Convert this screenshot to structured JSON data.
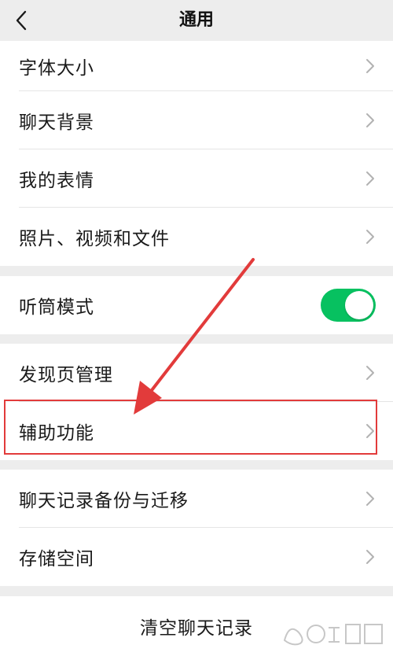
{
  "header": {
    "title": "通用"
  },
  "groups": {
    "display": [
      {
        "label": "字体大小"
      },
      {
        "label": "聊天背景"
      },
      {
        "label": "我的表情"
      },
      {
        "label": "照片、视频和文件"
      }
    ],
    "earpiece": {
      "label": "听筒模式",
      "toggle_on": true
    },
    "discover": [
      {
        "label": "发现页管理"
      },
      {
        "label": "辅助功能"
      }
    ],
    "storage": [
      {
        "label": "聊天记录备份与迁移"
      },
      {
        "label": "存储空间"
      }
    ],
    "clear": {
      "label": "清空聊天记录"
    }
  },
  "colors": {
    "accent_green": "#07c160",
    "annotation_red": "#e23b3b",
    "background": "#ededed"
  },
  "icons": {
    "back": "chevron-left-icon",
    "row_arrow": "chevron-right-icon"
  }
}
